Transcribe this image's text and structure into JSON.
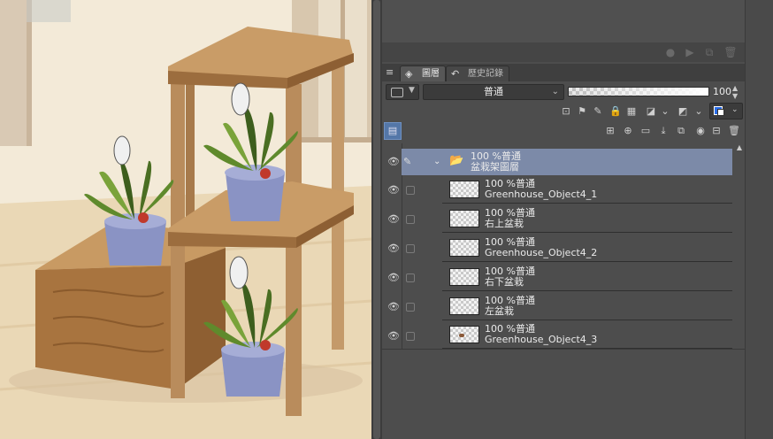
{
  "panel": {
    "tabs": [
      {
        "label": "圖層",
        "icon": "layers-icon"
      },
      {
        "label": "歷史記錄",
        "icon": "history-icon"
      }
    ],
    "blend_mode": "普通",
    "opacity": "100",
    "folder": {
      "mode": "100 %普通",
      "name": "盆栽架圖層"
    },
    "layers": [
      {
        "mode": "100 %普通",
        "name": "Greenhouse_Object4_1"
      },
      {
        "mode": "100 %普通",
        "name": "右上盆栽"
      },
      {
        "mode": "100 %普通",
        "name": "Greenhouse_Object4_2"
      },
      {
        "mode": "100 %普通",
        "name": "右下盆栽"
      },
      {
        "mode": "100 %普通",
        "name": "左盆栽"
      },
      {
        "mode": "100 %普通",
        "name": "Greenhouse_Object4_3"
      }
    ],
    "colors": {
      "selected_folder": "#7c8aa8",
      "main_color": "#2a6de8"
    }
  }
}
